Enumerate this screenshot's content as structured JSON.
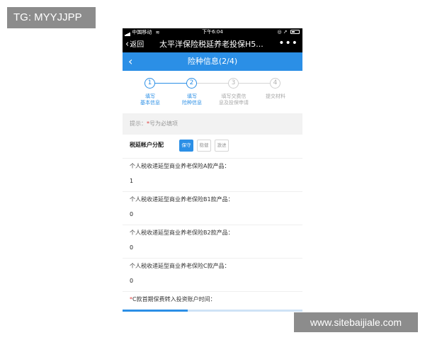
{
  "watermarks": {
    "top_left": "TG: MYYJJPP",
    "bottom_right": "www.sitebaijiale.com"
  },
  "status_bar": {
    "carrier": "中国移动",
    "time": "下午6:04"
  },
  "webview_nav": {
    "back_label": "返回",
    "title": "太平洋保险税延养老投保H5..."
  },
  "header": {
    "title": "险种信息(2/4)"
  },
  "steps": [
    {
      "number": "1",
      "line1": "填写",
      "line2": "基本信息",
      "active": true
    },
    {
      "number": "2",
      "line1": "填写",
      "line2": "险种信息",
      "active": true
    },
    {
      "number": "3",
      "line1": "填写交费信",
      "line2": "息及投保申请",
      "active": false
    },
    {
      "number": "4",
      "line1": "提交材料",
      "line2": "",
      "active": false
    }
  ],
  "hint": {
    "prefix": "提示：",
    "star": "*",
    "text": "号为必填项"
  },
  "allocation": {
    "label": "税延帐户分配",
    "options": [
      "保守",
      "稳健",
      "激进"
    ],
    "selected": "保守"
  },
  "fields": [
    {
      "label": "个人税收递延型商业养老保险A款产品：",
      "value": "1"
    },
    {
      "label": "个人税收递延型商业养老保险B1款产品：",
      "value": "0"
    },
    {
      "label": "个人税收递延型商业养老保险B2款产品：",
      "value": "0"
    },
    {
      "label": "个人税收递延型商业养老保险C款产品：",
      "value": "0"
    }
  ],
  "last_field": {
    "star": "*",
    "label": "C款首期保费转入投资账户时间："
  },
  "colors": {
    "accent": "#2b8fe6",
    "required": "#e03b3b"
  }
}
